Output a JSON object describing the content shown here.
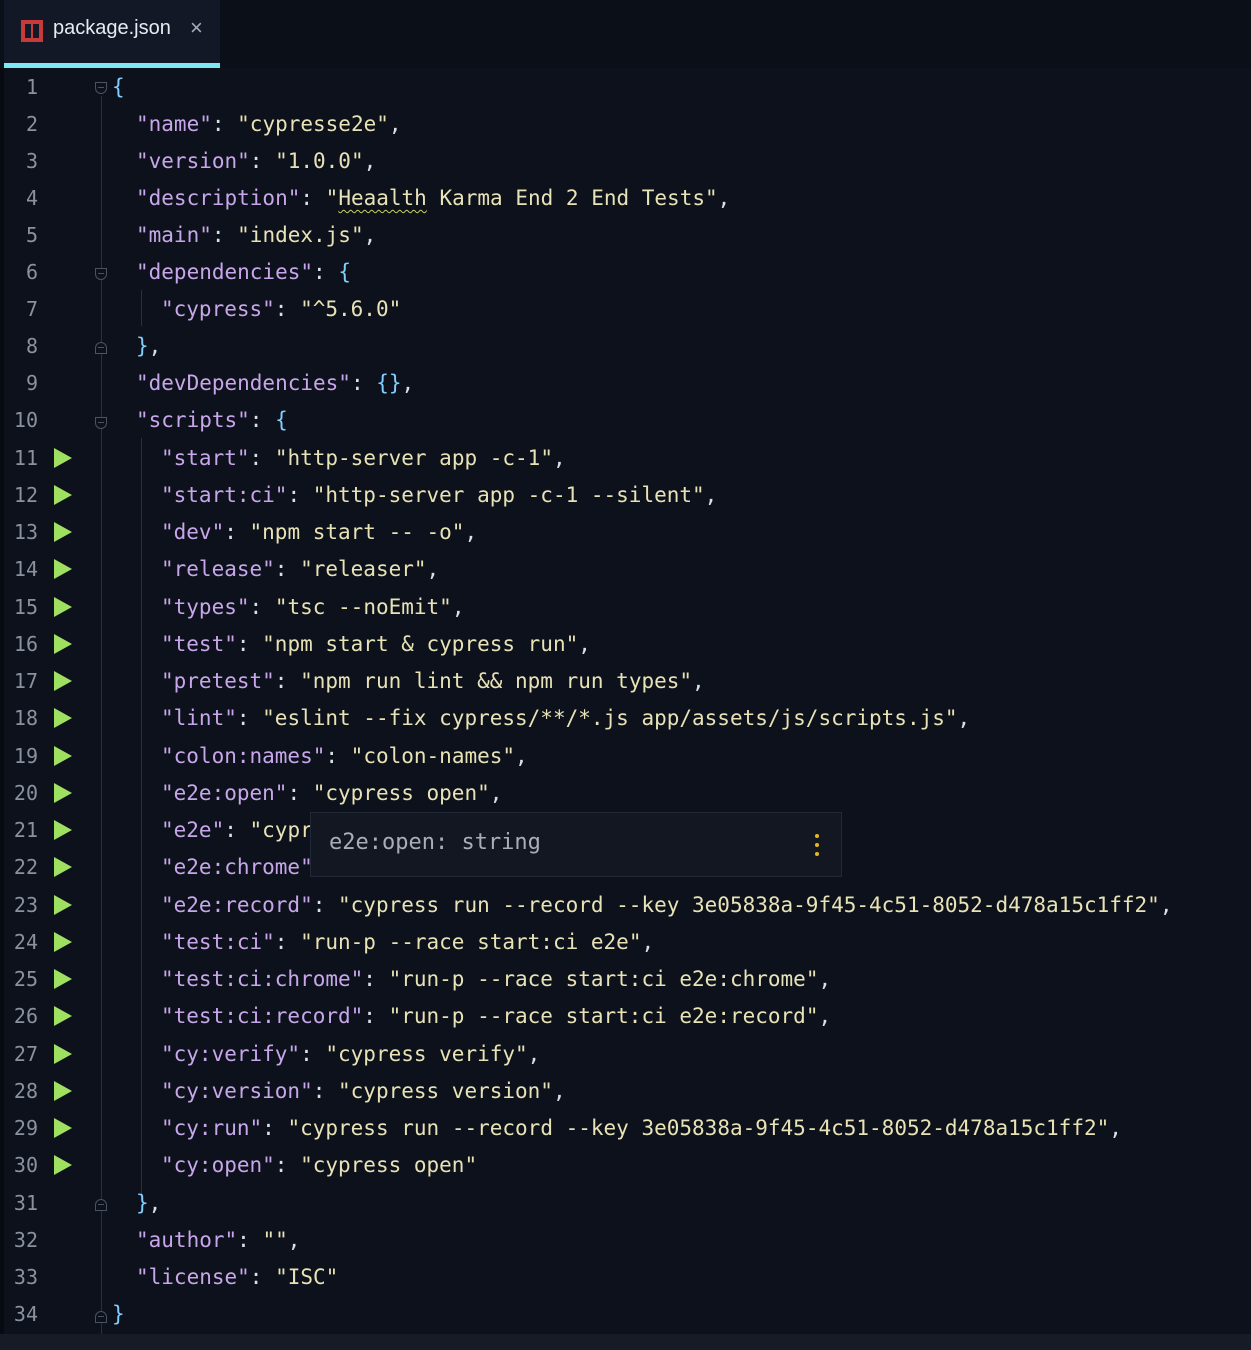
{
  "tab": {
    "title": "package.json",
    "close": "×",
    "icon": "npm-icon"
  },
  "lines": [
    {
      "n": "1"
    },
    {
      "n": "2"
    },
    {
      "n": "3"
    },
    {
      "n": "4"
    },
    {
      "n": "5"
    },
    {
      "n": "6"
    },
    {
      "n": "7"
    },
    {
      "n": "8"
    },
    {
      "n": "9"
    },
    {
      "n": "10"
    },
    {
      "n": "11"
    },
    {
      "n": "12"
    },
    {
      "n": "13"
    },
    {
      "n": "14"
    },
    {
      "n": "15"
    },
    {
      "n": "16"
    },
    {
      "n": "17"
    },
    {
      "n": "18"
    },
    {
      "n": "19"
    },
    {
      "n": "20"
    },
    {
      "n": "21"
    },
    {
      "n": "22"
    },
    {
      "n": "23"
    },
    {
      "n": "24"
    },
    {
      "n": "25"
    },
    {
      "n": "26"
    },
    {
      "n": "27"
    },
    {
      "n": "28"
    },
    {
      "n": "29"
    },
    {
      "n": "30"
    },
    {
      "n": "31"
    },
    {
      "n": "32"
    },
    {
      "n": "33"
    },
    {
      "n": "34"
    }
  ],
  "code": {
    "open_brace": "{",
    "close_brace": "}",
    "name_key": "\"name\"",
    "name_val": "\"cypresse2e\"",
    "version_key": "\"version\"",
    "version_val": "\"1.0.0\"",
    "description_key": "\"description\"",
    "description_q": "\"",
    "description_word": "Heaalth",
    "description_rest": " Karma End 2 End Tests\"",
    "main_key": "\"main\"",
    "main_val": "\"index.js\"",
    "dependencies_key": "\"dependencies\"",
    "cypress_key": "\"cypress\"",
    "cypress_val": "\"^5.6.0\"",
    "devDependencies_key": "\"devDependencies\"",
    "devDependencies_val": "{}",
    "scripts_key": "\"scripts\"",
    "author_key": "\"author\"",
    "author_val": "\"\"",
    "license_key": "\"license\"",
    "license_val": "\"ISC\""
  },
  "scripts": [
    {
      "key": "\"start\"",
      "val": "\"http-server app -c-1\"",
      "comma": ","
    },
    {
      "key": "\"start:ci\"",
      "val": "\"http-server app -c-1 --silent\"",
      "comma": ","
    },
    {
      "key": "\"dev\"",
      "val": "\"npm start -- -o\"",
      "comma": ","
    },
    {
      "key": "\"release\"",
      "val": "\"releaser\"",
      "comma": ","
    },
    {
      "key": "\"types\"",
      "val": "\"tsc --noEmit\"",
      "comma": ","
    },
    {
      "key": "\"test\"",
      "val": "\"npm start & cypress run\"",
      "comma": ","
    },
    {
      "key": "\"pretest\"",
      "val": "\"npm run lint && npm run types\"",
      "comma": ","
    },
    {
      "key": "\"lint\"",
      "val": "\"eslint --fix cypress/**/*.js app/assets/js/scripts.js\"",
      "comma": ","
    },
    {
      "key": "\"colon:names\"",
      "val": "\"colon-names\"",
      "comma": ","
    },
    {
      "key": "\"e2e:open\"",
      "val": "\"cypress open\"",
      "comma": ","
    },
    {
      "key": "\"e2e\"",
      "val": "\"cypr",
      "comma": ""
    },
    {
      "key": "\"e2e:chrome\"",
      "val": "",
      "comma": ""
    },
    {
      "key": "\"e2e:record\"",
      "val": "\"cypress run --record --key 3e05838a-9f45-4c51-8052-d478a15c1ff2\"",
      "comma": ","
    },
    {
      "key": "\"test:ci\"",
      "val": "\"run-p --race start:ci e2e\"",
      "comma": ","
    },
    {
      "key": "\"test:ci:chrome\"",
      "val": "\"run-p --race start:ci e2e:chrome\"",
      "comma": ","
    },
    {
      "key": "\"test:ci:record\"",
      "val": "\"run-p --race start:ci e2e:record\"",
      "comma": ","
    },
    {
      "key": "\"cy:verify\"",
      "val": "\"cypress verify\"",
      "comma": ","
    },
    {
      "key": "\"cy:version\"",
      "val": "\"cypress version\"",
      "comma": ","
    },
    {
      "key": "\"cy:run\"",
      "val": "\"cypress run --record --key 3e05838a-9f45-4c51-8052-d478a15c1ff2\"",
      "comma": ","
    },
    {
      "key": "\"cy:open\"",
      "val": "\"cypress open\"",
      "comma": ""
    }
  ],
  "tooltip": {
    "text": "e2e:open: string",
    "menu_icon": "more-vertical-icon"
  },
  "colors": {
    "key": "#c7a7ea",
    "string": "#e8e2b7",
    "run_arrow": "#9fe061",
    "tab_accent": "#7fe7f3",
    "tooltip_dots": "#e6b820"
  }
}
